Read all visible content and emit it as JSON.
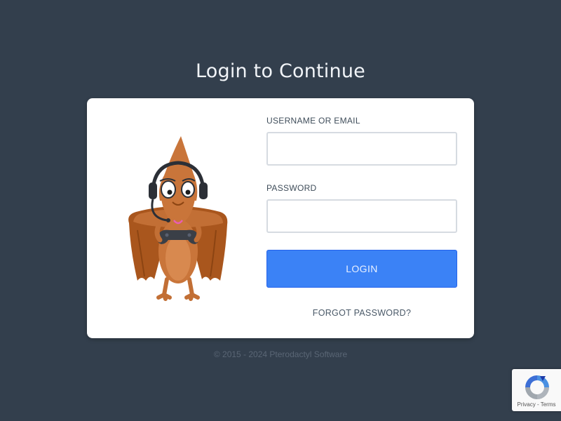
{
  "page": {
    "title": "Login to Continue"
  },
  "form": {
    "username_label": "USERNAME OR EMAIL",
    "username_value": "",
    "password_label": "PASSWORD",
    "password_value": "",
    "login_label": "LOGIN",
    "forgot_label": "FORGOT PASSWORD?"
  },
  "footer": {
    "copyright": "© 2015 - 2024 Pterodactyl Software"
  },
  "recaptcha": {
    "privacy_label": "Privacy",
    "separator": " - ",
    "terms_label": "Terms"
  },
  "colors": {
    "background": "#333f4d",
    "card": "#ffffff",
    "accent": "#3b82f6",
    "mascot_body": "#c9753a"
  },
  "icons": {
    "mascot": "pterodactyl-mascot",
    "recaptcha": "recaptcha-icon"
  }
}
